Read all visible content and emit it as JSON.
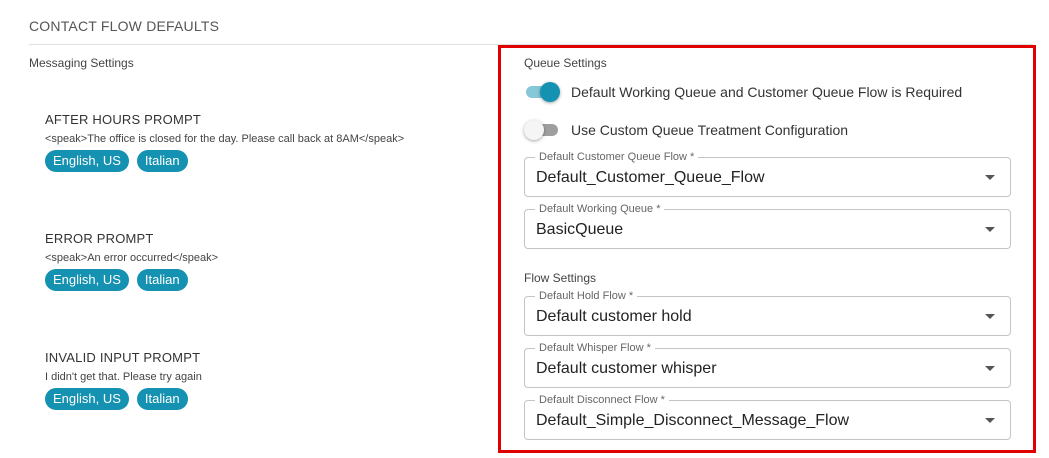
{
  "page": {
    "title": "CONTACT FLOW DEFAULTS"
  },
  "messaging": {
    "label": "Messaging Settings",
    "prompts": [
      {
        "title": "AFTER HOURS PROMPT",
        "text": "<speak>The office is closed for the day. Please call back at 8AM</speak>",
        "chips": [
          "English, US",
          "Italian"
        ]
      },
      {
        "title": "ERROR PROMPT",
        "text": "<speak>An error occurred</speak>",
        "chips": [
          "English, US",
          "Italian"
        ]
      },
      {
        "title": "INVALID INPUT PROMPT",
        "text": "I didn't get that. Please try again",
        "chips": [
          "English, US",
          "Italian"
        ]
      }
    ]
  },
  "queue_settings": {
    "label": "Queue Settings",
    "toggle_required": {
      "label": "Default Working Queue and Customer Queue Flow is Required",
      "on": true
    },
    "toggle_custom": {
      "label": "Use Custom Queue Treatment Configuration",
      "on": false
    },
    "customer_queue_flow": {
      "label": "Default Customer Queue Flow *",
      "value": "Default_Customer_Queue_Flow"
    },
    "working_queue": {
      "label": "Default Working Queue *",
      "value": "BasicQueue"
    }
  },
  "flow_settings": {
    "label": "Flow Settings",
    "hold_flow": {
      "label": "Default Hold Flow *",
      "value": "Default customer hold"
    },
    "whisper_flow": {
      "label": "Default Whisper Flow *",
      "value": "Default customer whisper"
    },
    "disconnect_flow": {
      "label": "Default Disconnect Flow *",
      "value": "Default_Simple_Disconnect_Message_Flow"
    }
  },
  "colors": {
    "accent": "#1591b2",
    "highlight": "#e00000"
  }
}
